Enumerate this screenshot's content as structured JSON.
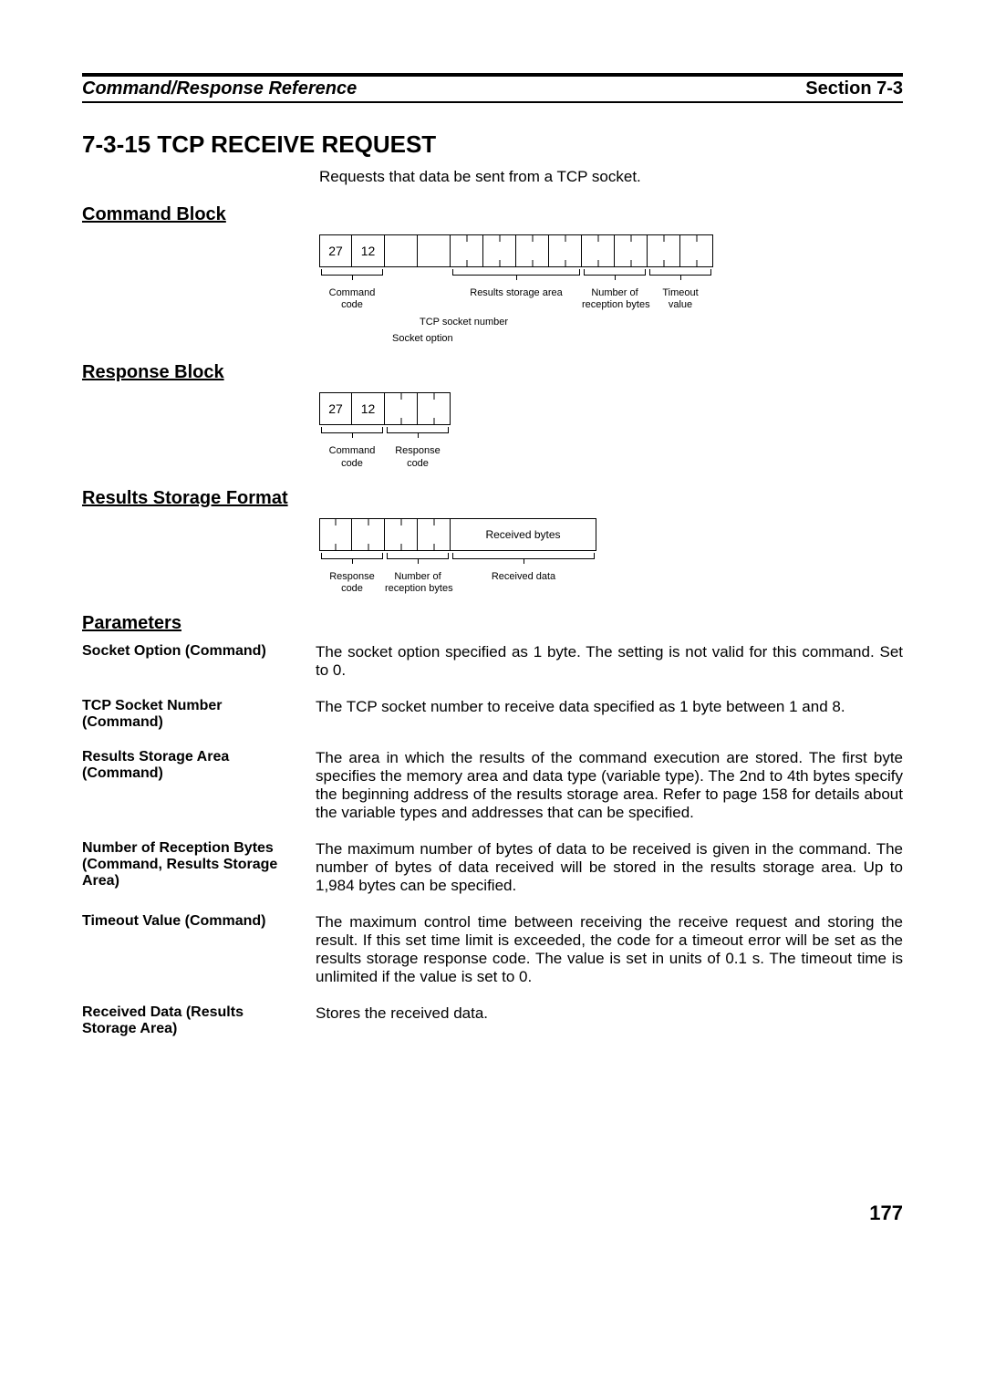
{
  "header": {
    "left": "Command/Response Reference",
    "right": "Section 7-3"
  },
  "title": "7-3-15  TCP RECEIVE REQUEST",
  "intro": "Requests that data be sent from a TCP socket.",
  "headings": {
    "command_block": "Command Block",
    "response_block": "Response Block",
    "results_storage": "Results Storage Format",
    "parameters": "Parameters"
  },
  "cmd_block": {
    "b0": "27",
    "b1": "12",
    "l_command_code": "Command\ncode",
    "l_socket_option": "Socket option",
    "l_tcp_socket": "TCP socket number",
    "l_results_storage": "Results storage area",
    "l_num_recv": "Number of\nreception bytes",
    "l_timeout": "Timeout\nvalue"
  },
  "resp_block": {
    "b0": "27",
    "b1": "12",
    "l_command_code": "Command\ncode",
    "l_response_code": "Response\ncode"
  },
  "results_fmt": {
    "l_received_bytes": "Received bytes",
    "l_response_code": "Response\ncode",
    "l_num_recv": "Number of\nreception bytes",
    "l_received_data": "Received data"
  },
  "params": [
    {
      "label": "Socket Option (Command)",
      "desc": "The socket option specified as 1 byte. The setting is not valid for this command. Set to 0."
    },
    {
      "label": "TCP Socket Number (Command)",
      "desc": "The TCP socket number to receive data specified as 1 byte between 1 and 8."
    },
    {
      "label": "Results Storage Area (Command)",
      "desc": "The area in which the results of the command execution are stored. The first byte specifies the memory area and data type (variable type). The 2nd to 4th bytes specify the beginning address of the results storage area. Refer to page 158 for details about the variable types and addresses that can be specified."
    },
    {
      "label": "Number of Reception Bytes (Command, Results Storage Area)",
      "desc": "The maximum number of bytes of data to be received is given in the command. The number of bytes of data received will be stored in the results storage area. Up to 1,984 bytes can be specified."
    },
    {
      "label": "Timeout Value (Command)",
      "desc": "The maximum control time between receiving the receive request and storing the result. If this set time limit is exceeded, the code for a timeout error will be set as the results storage response code. The value is set in units of 0.1 s. The timeout time is unlimited if the value is set to 0."
    },
    {
      "label": "Received Data (Results Storage Area)",
      "desc": "Stores the received data."
    }
  ],
  "page_number": "177"
}
